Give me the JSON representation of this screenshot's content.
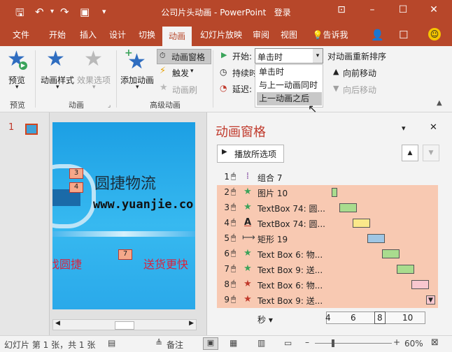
{
  "window": {
    "title": "公司片头动画 - PowerPoint",
    "login": "登录",
    "quick_access": [
      "save-icon",
      "undo-icon",
      "redo-icon",
      "present-icon"
    ]
  },
  "tabs": [
    {
      "label": "文件",
      "active": false
    },
    {
      "label": "开始",
      "active": false
    },
    {
      "label": "插入",
      "active": false
    },
    {
      "label": "设计",
      "active": false
    },
    {
      "label": "切换",
      "active": false
    },
    {
      "label": "动画",
      "active": true
    },
    {
      "label": "幻灯片放映",
      "active": false
    },
    {
      "label": "审阅",
      "active": false
    },
    {
      "label": "视图",
      "active": false
    },
    {
      "label": "告诉我",
      "active": false
    }
  ],
  "ribbon": {
    "preview": {
      "label": "预览",
      "group": "预览"
    },
    "animation_styles": {
      "label": "动画样式"
    },
    "effect_options": {
      "label": "效果选项"
    },
    "animation_group": "动画",
    "add_animation": {
      "label": "添加动画"
    },
    "animation_pane": {
      "label": "动画窗格"
    },
    "trigger": {
      "label": "触发"
    },
    "animation_painter": {
      "label": "动画刷"
    },
    "advanced_group": "高级动画",
    "start_label": "开始:",
    "start_value": "单击时",
    "duration_label": "持续时",
    "delay_label": "延迟:",
    "reorder_title": "对动画重新排序",
    "move_earlier": "向前移动",
    "move_later": "向后移动"
  },
  "dropdown": {
    "options": [
      "单击时",
      "与上一动画同时",
      "上一动画之后"
    ],
    "highlighted_index": 2
  },
  "thumbnails": {
    "number": "1"
  },
  "slide": {
    "title_text": "圆捷物流",
    "url_text": "www.yuanjie.co",
    "left_text": "找圆捷",
    "right_text": "送货更快",
    "tags": [
      "3",
      "4",
      "7"
    ]
  },
  "anim_pane": {
    "title": "动画窗格",
    "play_button": "播放所选项",
    "items": [
      {
        "num": "1",
        "icon": "group-anim-icon",
        "name": "组合 7",
        "selected": false
      },
      {
        "num": "2",
        "icon": "green-star-icon",
        "name": "图片 10",
        "selected": true,
        "bar_start": 0.0,
        "bar_len": 0.03,
        "bar_color": "#a9dc8e"
      },
      {
        "num": "3",
        "icon": "green-star-icon",
        "name": "TextBox 74: 圆...",
        "selected": true,
        "bar_start": 0.06,
        "bar_len": 0.12,
        "bar_color": "#a9dc8e"
      },
      {
        "num": "4",
        "icon": "font-color-icon",
        "name": "TextBox 74: 圆...",
        "selected": true,
        "bar_start": 0.16,
        "bar_len": 0.12,
        "bar_color": "#fbe88a"
      },
      {
        "num": "5",
        "icon": "motion-path-icon",
        "name": "矩形 19",
        "selected": true,
        "bar_start": 0.27,
        "bar_len": 0.12,
        "bar_color": "#9fc6e4"
      },
      {
        "num": "6",
        "icon": "green-star-icon",
        "name": "Text Box 6: 物...",
        "selected": true,
        "bar_start": 0.38,
        "bar_len": 0.12,
        "bar_color": "#a9dc8e"
      },
      {
        "num": "7",
        "icon": "green-star-icon",
        "name": "Text Box 9: 送...",
        "selected": true,
        "bar_start": 0.49,
        "bar_len": 0.12,
        "bar_color": "#a9dc8e"
      },
      {
        "num": "8",
        "icon": "red-star-icon",
        "name": "Text Box 6: 物...",
        "selected": true,
        "bar_start": 0.6,
        "bar_len": 0.12,
        "bar_color": "#f8c7cf"
      },
      {
        "num": "9",
        "icon": "red-star-icon",
        "name": "Text Box 9: 送...",
        "selected": true,
        "bar_start": 0.71,
        "bar_len": 0.06,
        "bar_color": "#f8c7cf"
      }
    ],
    "timeline_unit": "秒",
    "timeline_ticks": [
      "4",
      "6",
      "8",
      "10"
    ]
  },
  "status": {
    "slide_info": "幻灯片 第 1 张，共 1 张",
    "notes": "备注",
    "zoom": "60%"
  }
}
